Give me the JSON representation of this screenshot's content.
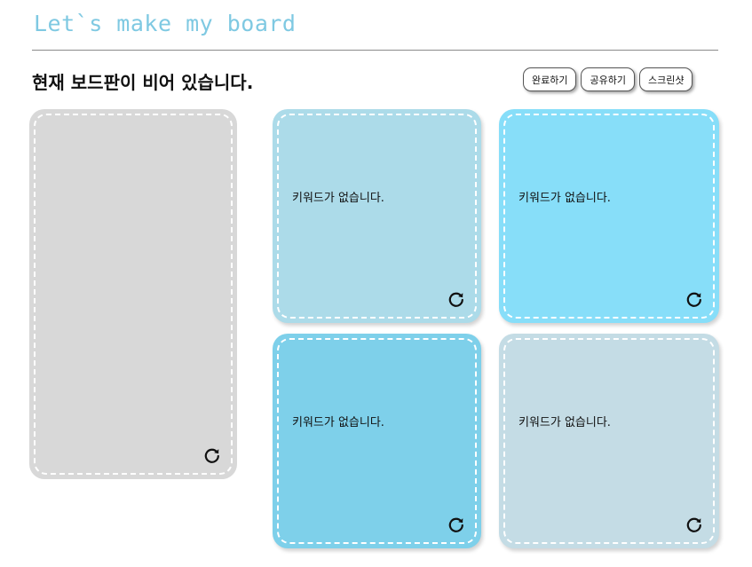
{
  "app": {
    "title": "Let`s make my board"
  },
  "board": {
    "status": "현재 보드판이 비어 있습니다."
  },
  "toolbar": {
    "done_label": "완료하기",
    "share_label": "공유하기",
    "screenshot_label": "스크린샷"
  },
  "cards": {
    "main": {
      "color": "#d8d8d8"
    },
    "items": [
      {
        "text": "키워드가 없습니다.",
        "color": "#acdbe9"
      },
      {
        "text": "키워드가 없습니다.",
        "color": "#87def9"
      },
      {
        "text": "키워드가 없습니다.",
        "color": "#7ed0ea"
      },
      {
        "text": "키워드가 없습니다.",
        "color": "#c4dce5"
      }
    ],
    "refresh_icon": "refresh-icon"
  }
}
